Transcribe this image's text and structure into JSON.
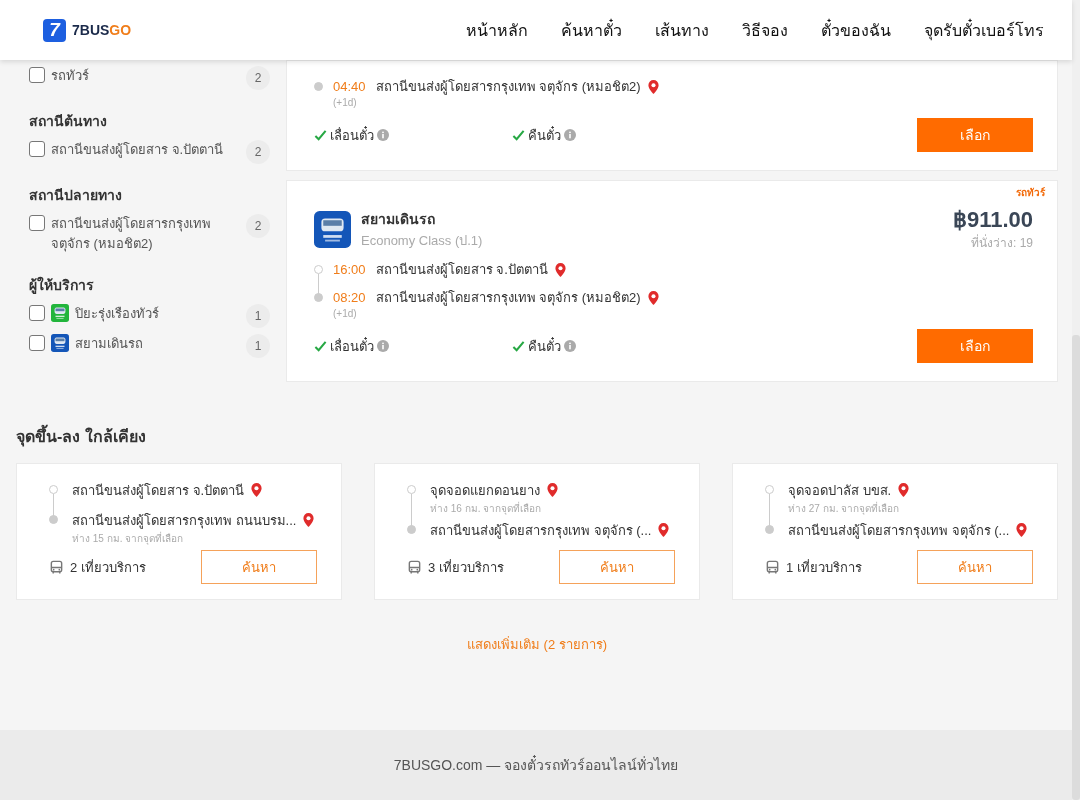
{
  "header": {
    "logo": {
      "mark": "7",
      "name_a": "7BUS",
      "name_b": "GO"
    },
    "nav": [
      "หน้าหลัก",
      "ค้นหาตั๋ว",
      "เส้นทาง",
      "วิธีจอง",
      "ตั๋วของฉัน",
      "จุดรับตั๋วเบอร์โทร"
    ]
  },
  "filters": [
    {
      "items": [
        {
          "label": "รถทัวร์",
          "count": "2",
          "checked": false
        }
      ]
    },
    {
      "title": "สถานีต้นทาง",
      "items": [
        {
          "label": "สถานีขนส่งผู้โดยสาร จ.ปัตตานี",
          "count": "2",
          "checked": false
        }
      ]
    },
    {
      "title": "สถานีปลายทาง",
      "items": [
        {
          "label": "สถานีขนส่งผู้โดยสารกรุงเทพ จตุจักร (หมอชิต2)",
          "count": "2",
          "checked": false
        }
      ]
    },
    {
      "title": "ผู้ให้บริการ",
      "items": [
        {
          "label": "ปิยะรุ่งเรืองทัวร์",
          "count": "1",
          "checked": false,
          "color": "#22b53c"
        },
        {
          "label": "สยามเดินรถ",
          "count": "1",
          "checked": false,
          "color": "#1456b8"
        }
      ]
    }
  ],
  "trips": [
    {
      "stops": [
        {
          "kind": "arrival",
          "time": "04:40",
          "station": "สถานีขนส่งผู้โดยสารกรุงเทพ จตุจักร (หมอชิต2)",
          "day_offset": "(+1d)"
        }
      ],
      "features": [
        {
          "label": "เลื่อนตั๋ว",
          "available": true
        },
        {
          "label": "คืนตั๋ว",
          "available": true
        }
      ],
      "button": "เลือก"
    },
    {
      "tag": "รถทัวร์",
      "operator": "สยามเดินรถ",
      "class": "Economy Class (ป.1)",
      "price": "฿911.00",
      "seats": "ที่นั่งว่าง: 19",
      "stops": [
        {
          "kind": "departure",
          "time": "16:00",
          "station": "สถานีขนส่งผู้โดยสาร จ.ปัตตานี"
        },
        {
          "kind": "arrival",
          "time": "08:20",
          "station": "สถานีขนส่งผู้โดยสารกรุงเทพ จตุจักร (หมอชิต2)",
          "day_offset": "(+1d)"
        }
      ],
      "features": [
        {
          "label": "เลื่อนตั๋ว",
          "available": true
        },
        {
          "label": "คืนตั๋ว",
          "available": true
        }
      ],
      "button": "เลือก"
    }
  ],
  "nearby": {
    "title": "จุดขึ้น-ลง ใกล้เคียง",
    "cards": [
      {
        "stops": [
          {
            "kind": "departure",
            "name": "สถานีขนส่งผู้โดยสาร จ.ปัตตานี"
          },
          {
            "kind": "arrival",
            "name": "สถานีขนส่งผู้โดยสารกรุงเทพ ถนนบรม...",
            "distance": "ห่าง 15 กม. จากจุดที่เลือก"
          }
        ],
        "trips": "2 เที่ยวบริการ",
        "button": "ค้นหา"
      },
      {
        "stops": [
          {
            "kind": "departure",
            "name": "จุดจอดแยกดอนยาง",
            "distance": "ห่าง 16 กม. จากจุดที่เลือก"
          },
          {
            "kind": "arrival",
            "name": "สถานีขนส่งผู้โดยสารกรุงเทพ จตุจักร (..."
          }
        ],
        "trips": "3 เที่ยวบริการ",
        "button": "ค้นหา"
      },
      {
        "stops": [
          {
            "kind": "departure",
            "name": "จุดจอดปาลัส บขส.",
            "distance": "ห่าง 27 กม. จากจุดที่เลือก"
          },
          {
            "kind": "arrival",
            "name": "สถานีขนส่งผู้โดยสารกรุงเทพ จตุจักร (..."
          }
        ],
        "trips": "1 เที่ยวบริการ",
        "button": "ค้นหา"
      }
    ]
  },
  "show_more": "แสดงเพิ่มเติม (2 รายการ)",
  "footer": "7BUSGO.com — จองตั๋วรถทัวร์ออนไลน์ทั่วไทย"
}
